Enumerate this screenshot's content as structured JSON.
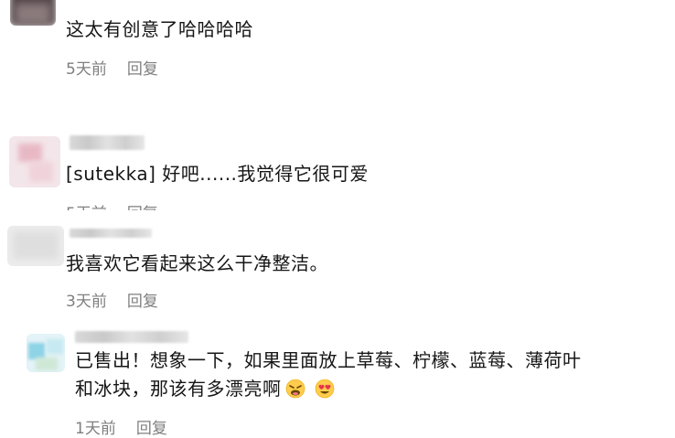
{
  "comments": [
    {
      "text": "这太有创意了哈哈哈哈",
      "time": "5天前",
      "reply": "回复"
    },
    {
      "text": "[sutekka] 好吧......我觉得它很可爱",
      "time": "5天前",
      "reply": "回复"
    },
    {
      "text": "我喜欢它看起来这么干净整洁。",
      "time": "3天前",
      "reply": "回复"
    },
    {
      "text_line1": "已售出！想象一下，如果里面放上草莓、柠檬、蓝莓、薄荷叶",
      "text_line2": "和冰块，那该有多漂亮啊",
      "emojis": [
        "weary-face-emoji",
        "heart-eyes-emoji"
      ],
      "time": "1天前",
      "reply": "回复"
    }
  ]
}
